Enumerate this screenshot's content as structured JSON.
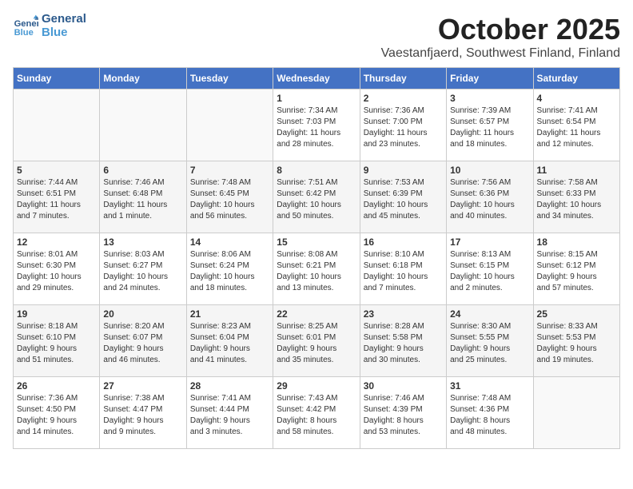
{
  "header": {
    "logo_line1": "General",
    "logo_line2": "Blue",
    "month": "October 2025",
    "location": "Vaestanfjaerd, Southwest Finland, Finland"
  },
  "weekdays": [
    "Sunday",
    "Monday",
    "Tuesday",
    "Wednesday",
    "Thursday",
    "Friday",
    "Saturday"
  ],
  "weeks": [
    [
      {
        "day": "",
        "info": ""
      },
      {
        "day": "",
        "info": ""
      },
      {
        "day": "",
        "info": ""
      },
      {
        "day": "1",
        "info": "Sunrise: 7:34 AM\nSunset: 7:03 PM\nDaylight: 11 hours\nand 28 minutes."
      },
      {
        "day": "2",
        "info": "Sunrise: 7:36 AM\nSunset: 7:00 PM\nDaylight: 11 hours\nand 23 minutes."
      },
      {
        "day": "3",
        "info": "Sunrise: 7:39 AM\nSunset: 6:57 PM\nDaylight: 11 hours\nand 18 minutes."
      },
      {
        "day": "4",
        "info": "Sunrise: 7:41 AM\nSunset: 6:54 PM\nDaylight: 11 hours\nand 12 minutes."
      }
    ],
    [
      {
        "day": "5",
        "info": "Sunrise: 7:44 AM\nSunset: 6:51 PM\nDaylight: 11 hours\nand 7 minutes."
      },
      {
        "day": "6",
        "info": "Sunrise: 7:46 AM\nSunset: 6:48 PM\nDaylight: 11 hours\nand 1 minute."
      },
      {
        "day": "7",
        "info": "Sunrise: 7:48 AM\nSunset: 6:45 PM\nDaylight: 10 hours\nand 56 minutes."
      },
      {
        "day": "8",
        "info": "Sunrise: 7:51 AM\nSunset: 6:42 PM\nDaylight: 10 hours\nand 50 minutes."
      },
      {
        "day": "9",
        "info": "Sunrise: 7:53 AM\nSunset: 6:39 PM\nDaylight: 10 hours\nand 45 minutes."
      },
      {
        "day": "10",
        "info": "Sunrise: 7:56 AM\nSunset: 6:36 PM\nDaylight: 10 hours\nand 40 minutes."
      },
      {
        "day": "11",
        "info": "Sunrise: 7:58 AM\nSunset: 6:33 PM\nDaylight: 10 hours\nand 34 minutes."
      }
    ],
    [
      {
        "day": "12",
        "info": "Sunrise: 8:01 AM\nSunset: 6:30 PM\nDaylight: 10 hours\nand 29 minutes."
      },
      {
        "day": "13",
        "info": "Sunrise: 8:03 AM\nSunset: 6:27 PM\nDaylight: 10 hours\nand 24 minutes."
      },
      {
        "day": "14",
        "info": "Sunrise: 8:06 AM\nSunset: 6:24 PM\nDaylight: 10 hours\nand 18 minutes."
      },
      {
        "day": "15",
        "info": "Sunrise: 8:08 AM\nSunset: 6:21 PM\nDaylight: 10 hours\nand 13 minutes."
      },
      {
        "day": "16",
        "info": "Sunrise: 8:10 AM\nSunset: 6:18 PM\nDaylight: 10 hours\nand 7 minutes."
      },
      {
        "day": "17",
        "info": "Sunrise: 8:13 AM\nSunset: 6:15 PM\nDaylight: 10 hours\nand 2 minutes."
      },
      {
        "day": "18",
        "info": "Sunrise: 8:15 AM\nSunset: 6:12 PM\nDaylight: 9 hours\nand 57 minutes."
      }
    ],
    [
      {
        "day": "19",
        "info": "Sunrise: 8:18 AM\nSunset: 6:10 PM\nDaylight: 9 hours\nand 51 minutes."
      },
      {
        "day": "20",
        "info": "Sunrise: 8:20 AM\nSunset: 6:07 PM\nDaylight: 9 hours\nand 46 minutes."
      },
      {
        "day": "21",
        "info": "Sunrise: 8:23 AM\nSunset: 6:04 PM\nDaylight: 9 hours\nand 41 minutes."
      },
      {
        "day": "22",
        "info": "Sunrise: 8:25 AM\nSunset: 6:01 PM\nDaylight: 9 hours\nand 35 minutes."
      },
      {
        "day": "23",
        "info": "Sunrise: 8:28 AM\nSunset: 5:58 PM\nDaylight: 9 hours\nand 30 minutes."
      },
      {
        "day": "24",
        "info": "Sunrise: 8:30 AM\nSunset: 5:55 PM\nDaylight: 9 hours\nand 25 minutes."
      },
      {
        "day": "25",
        "info": "Sunrise: 8:33 AM\nSunset: 5:53 PM\nDaylight: 9 hours\nand 19 minutes."
      }
    ],
    [
      {
        "day": "26",
        "info": "Sunrise: 7:36 AM\nSunset: 4:50 PM\nDaylight: 9 hours\nand 14 minutes."
      },
      {
        "day": "27",
        "info": "Sunrise: 7:38 AM\nSunset: 4:47 PM\nDaylight: 9 hours\nand 9 minutes."
      },
      {
        "day": "28",
        "info": "Sunrise: 7:41 AM\nSunset: 4:44 PM\nDaylight: 9 hours\nand 3 minutes."
      },
      {
        "day": "29",
        "info": "Sunrise: 7:43 AM\nSunset: 4:42 PM\nDaylight: 8 hours\nand 58 minutes."
      },
      {
        "day": "30",
        "info": "Sunrise: 7:46 AM\nSunset: 4:39 PM\nDaylight: 8 hours\nand 53 minutes."
      },
      {
        "day": "31",
        "info": "Sunrise: 7:48 AM\nSunset: 4:36 PM\nDaylight: 8 hours\nand 48 minutes."
      },
      {
        "day": "",
        "info": ""
      }
    ]
  ]
}
